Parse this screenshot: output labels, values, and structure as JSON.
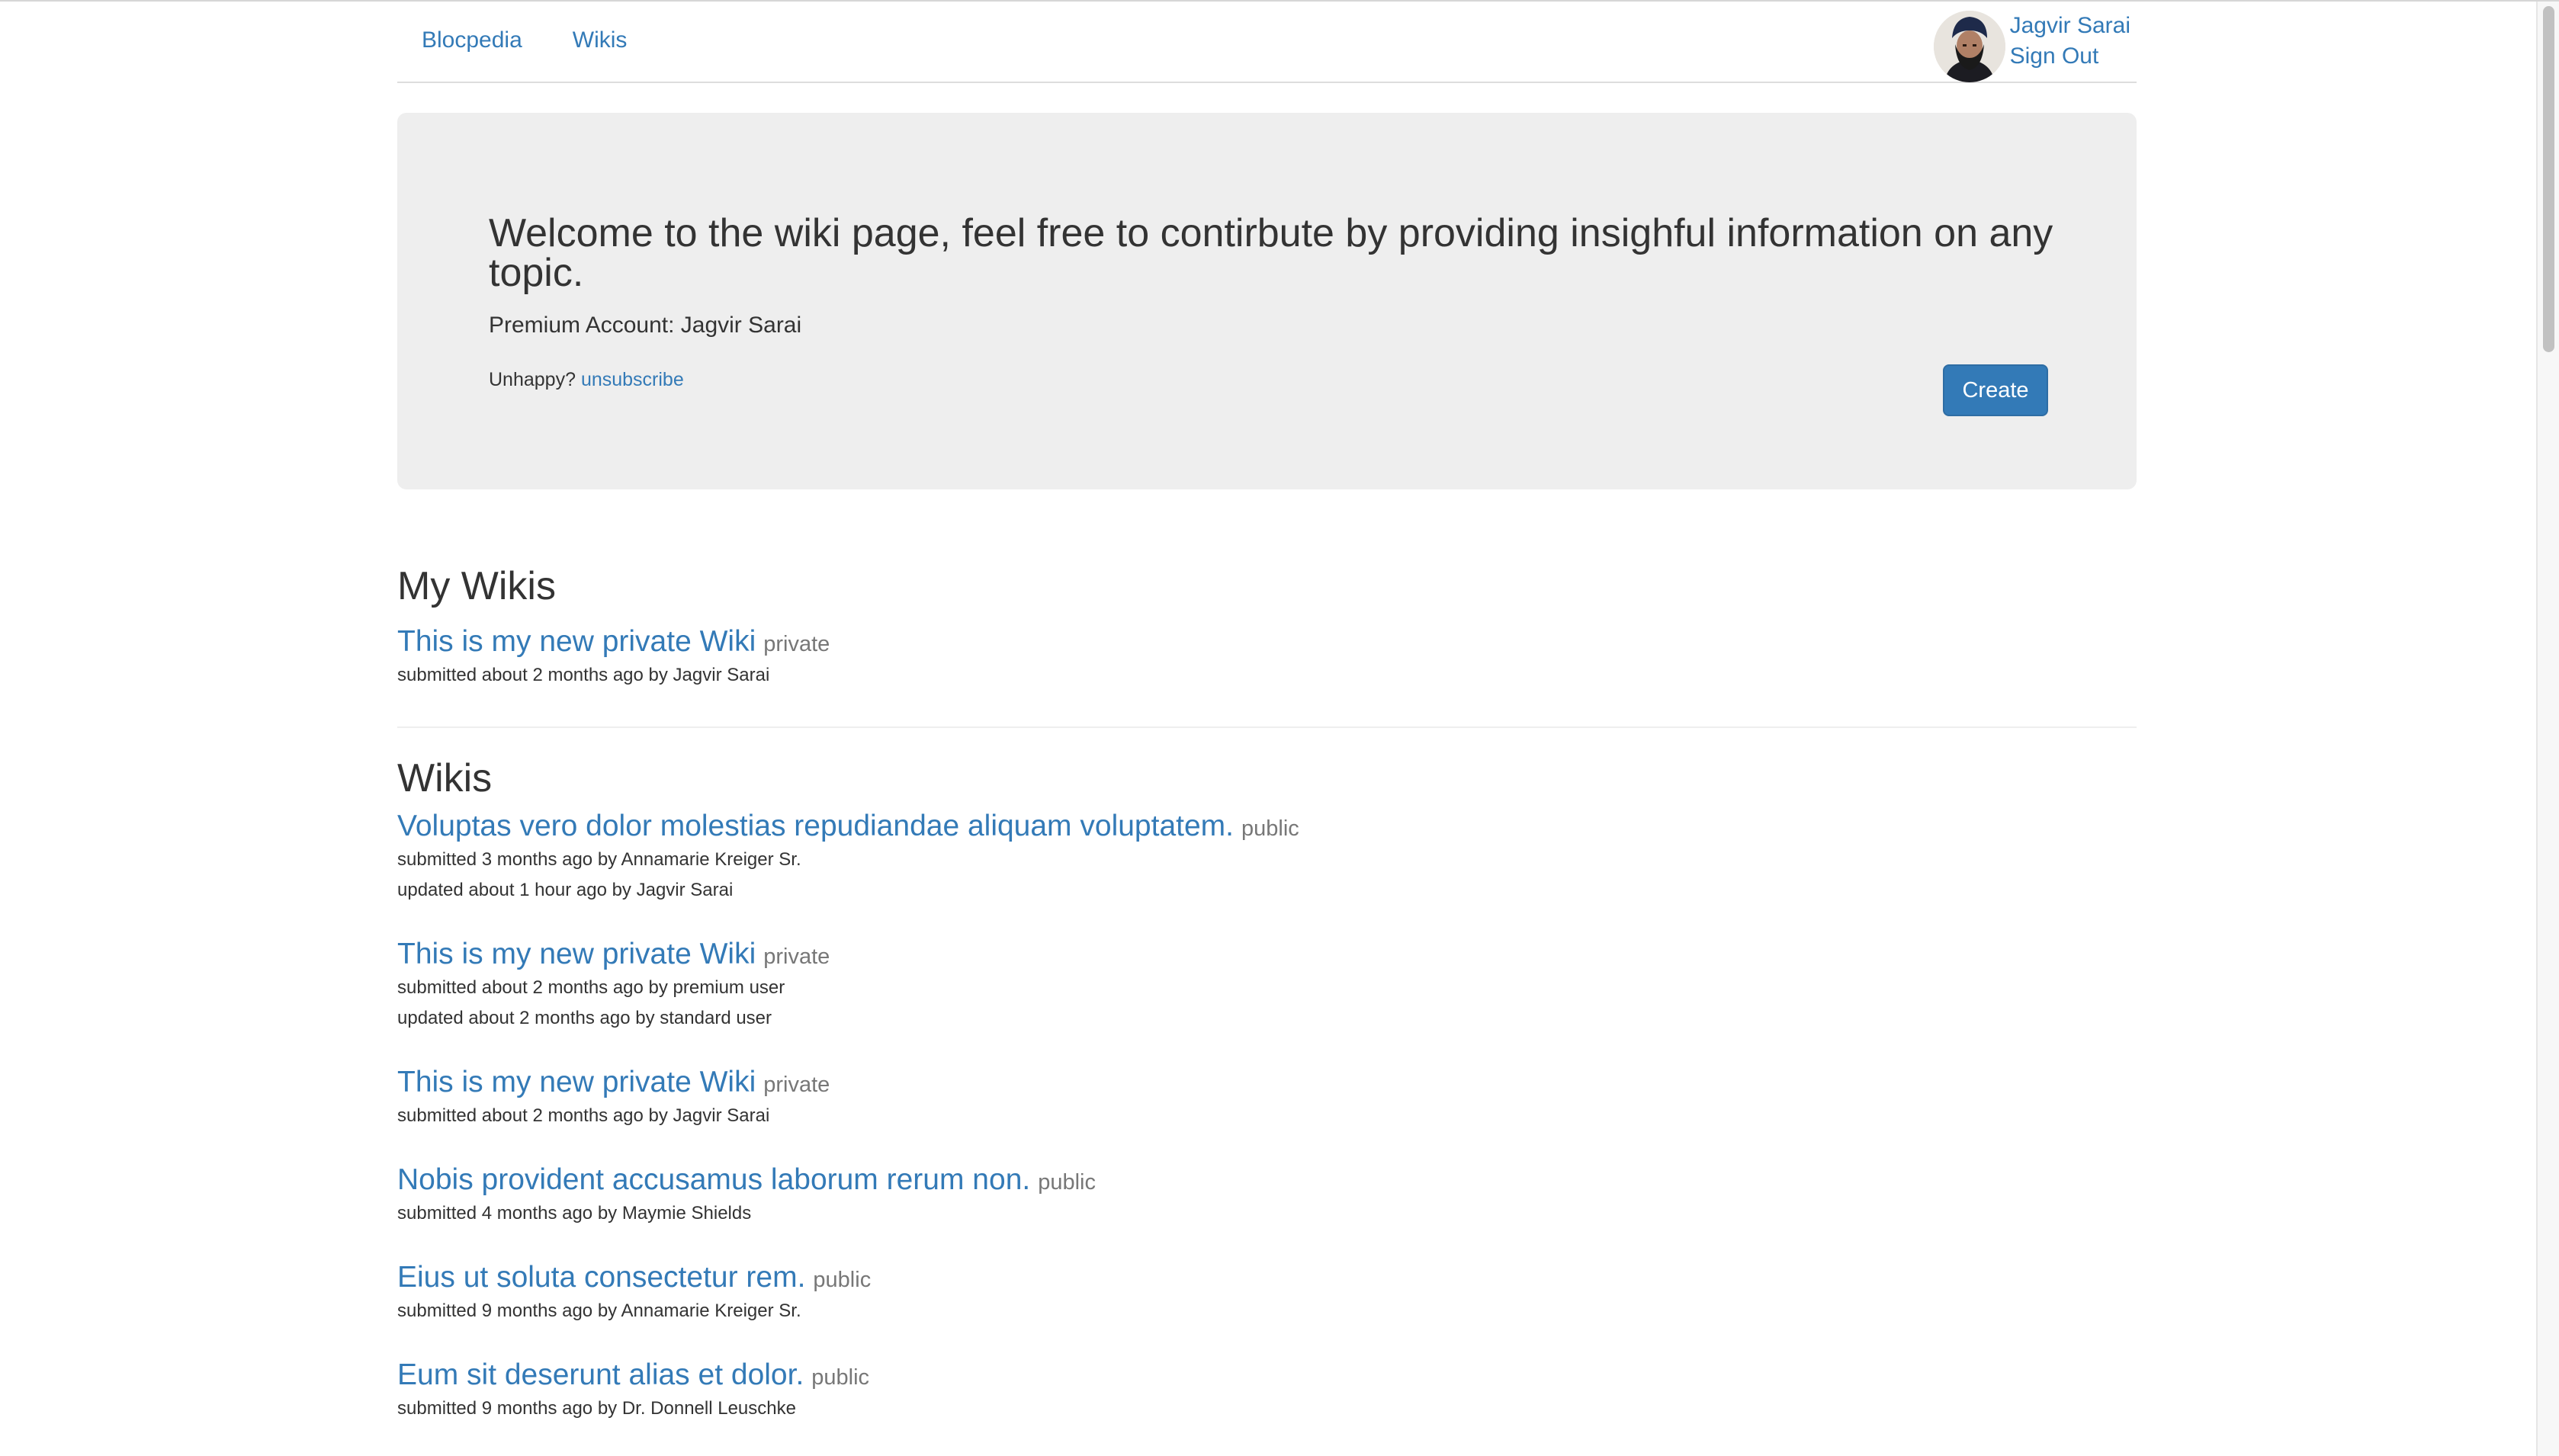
{
  "nav": {
    "brand": "Blocpedia",
    "wikis": "Wikis"
  },
  "user": {
    "name": "Jagvir Sarai",
    "sign_out": "Sign Out",
    "avatar_icon": "user-avatar"
  },
  "jumbotron": {
    "title": "Welcome to the wiki page, feel free to contirbute by providing insighful information on any topic.",
    "premium": "Premium Account: Jagvir Sarai",
    "unhappy": "Unhappy?",
    "unsubscribe": "unsubscribe",
    "create": "Create"
  },
  "my_wikis": {
    "heading": "My Wikis",
    "items": [
      {
        "title": "This is my new private Wiki",
        "visibility": "private",
        "submitted": "submitted about 2 months ago by Jagvir Sarai"
      }
    ]
  },
  "wikis": {
    "heading": "Wikis",
    "items": [
      {
        "title": "Voluptas vero dolor molestias repudiandae aliquam voluptatem.",
        "visibility": "public",
        "submitted": "submitted 3 months ago by Annamarie Kreiger Sr.",
        "updated": "updated about 1 hour ago by Jagvir Sarai"
      },
      {
        "title": "This is my new private Wiki",
        "visibility": "private",
        "submitted": "submitted about 2 months ago by premium user",
        "updated": "updated about 2 months ago by standard user"
      },
      {
        "title": "This is my new private Wiki",
        "visibility": "private",
        "submitted": "submitted about 2 months ago by Jagvir Sarai"
      },
      {
        "title": "Nobis provident accusamus laborum rerum non.",
        "visibility": "public",
        "submitted": "submitted 4 months ago by Maymie Shields"
      },
      {
        "title": "Eius ut soluta consectetur rem.",
        "visibility": "public",
        "submitted": "submitted 9 months ago by Annamarie Kreiger Sr."
      },
      {
        "title": "Eum sit deserunt alias et dolor.",
        "visibility": "public",
        "submitted": "submitted 9 months ago by Dr. Donnell Leuschke"
      }
    ]
  }
}
